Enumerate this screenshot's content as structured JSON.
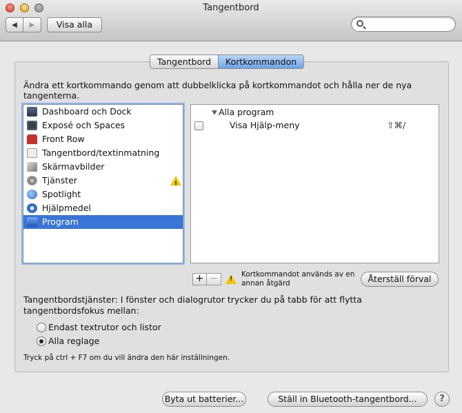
{
  "window": {
    "title": "Tangentbord"
  },
  "toolbar": {
    "back": "◀",
    "forward": "▶",
    "show_all": "Visa alla",
    "search_placeholder": ""
  },
  "tabs": [
    {
      "label": "Tangentbord",
      "active": false
    },
    {
      "label": "Kortkommandon",
      "active": true
    }
  ],
  "instructions": "Ändra ett kortkommando genom att dubbelklicka på kortkommandot och hålla ner de nya tangenterna.",
  "categories": [
    {
      "label": "Dashboard och Dock",
      "icon": "dashboard-dock-icon"
    },
    {
      "label": "Exposé och Spaces",
      "icon": "expose-spaces-icon"
    },
    {
      "label": "Front Row",
      "icon": "front-row-icon"
    },
    {
      "label": "Tangentbord/textinmatning",
      "icon": "keyboard-icon"
    },
    {
      "label": "Skärmavbilder",
      "icon": "screenshot-icon"
    },
    {
      "label": "Tjänster",
      "icon": "gear-icon",
      "warning": true
    },
    {
      "label": "Spotlight",
      "icon": "spotlight-icon"
    },
    {
      "label": "Hjälpmedel",
      "icon": "accessibility-icon"
    },
    {
      "label": "Program",
      "icon": "app-store-icon",
      "selected": true
    }
  ],
  "shortcuts": {
    "group": "Alla program",
    "items": [
      {
        "checked": false,
        "name": "Visa Hjälp-meny",
        "keys": "⇧⌘/"
      }
    ]
  },
  "list_controls": {
    "add": "+",
    "remove": "−"
  },
  "conflict_text": "Kortkommandot används av en annan åtgärd",
  "restore_defaults": "Återställ förval",
  "full_keyboard_access": {
    "label": "Tangentbordstjänster: I fönster och dialogrutor trycker du på tabb för att flytta tangentbordsfokus mellan:",
    "options": [
      {
        "label": "Endast textrutor och listor",
        "selected": false
      },
      {
        "label": "Alla reglage",
        "selected": true
      }
    ],
    "hint": "Tryck på ctrl + F7 om du vill ändra den här inställningen."
  },
  "footer": {
    "replace_batteries": "Byta ut batterier...",
    "bluetooth_setup": "Ställ in Bluetooth-tangentbord...",
    "help": "?"
  }
}
